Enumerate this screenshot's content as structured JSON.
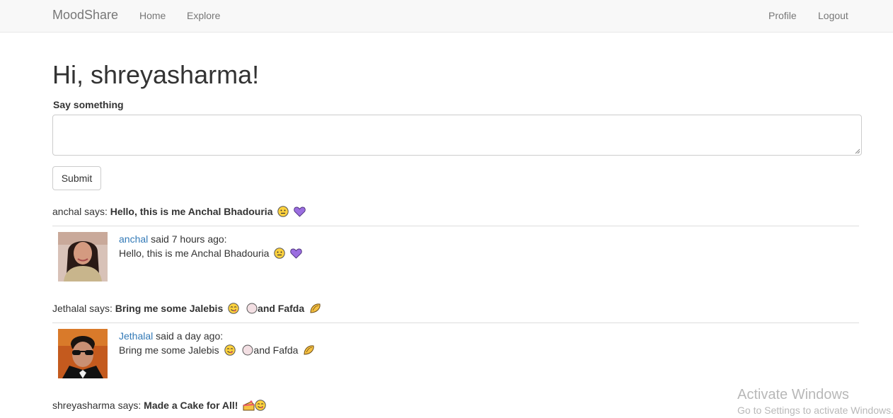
{
  "nav": {
    "brand": "MoodShare",
    "home": "Home",
    "explore": "Explore",
    "profile": "Profile",
    "logout": "Logout"
  },
  "greeting": "Hi, shreyasharma!",
  "form": {
    "label": "Say something",
    "value": "",
    "submit": "Submit"
  },
  "feed": [
    {
      "user": "anchal",
      "says_suffix": " says: ",
      "message": "Hello, this is me Anchal Bhadouria",
      "emojis": [
        "neutral-face-emoji",
        "purple-heart-emoji"
      ],
      "author": "anchal",
      "time_text": " said 7 hours ago:",
      "body": "Hello, this is me Anchal Bhadouria"
    },
    {
      "user": "Jethalal",
      "says_suffix": " says: ",
      "message_part1": "Bring me some Jalebis",
      "message_part2": "and Fafda",
      "emojis": [
        "yum-face-emoji",
        "round-pastry-emoji",
        "taco-emoji"
      ],
      "author": "Jethalal",
      "time_text": " said a day ago:",
      "body_part1": "Bring me some Jalebis",
      "body_part2": "and Fafda"
    },
    {
      "user": "shreyasharma",
      "says_suffix": " says: ",
      "message": "Made a Cake for All!",
      "emojis": [
        "cake-slice-emoji",
        "yum-face-emoji"
      ]
    }
  ],
  "watermark": {
    "title": "Activate Windows",
    "subtitle": "Go to Settings to activate Windows."
  },
  "colors": {
    "navbar_bg": "#f8f8f8",
    "link": "#337ab7",
    "text": "#333333",
    "nav_text": "#777777"
  }
}
